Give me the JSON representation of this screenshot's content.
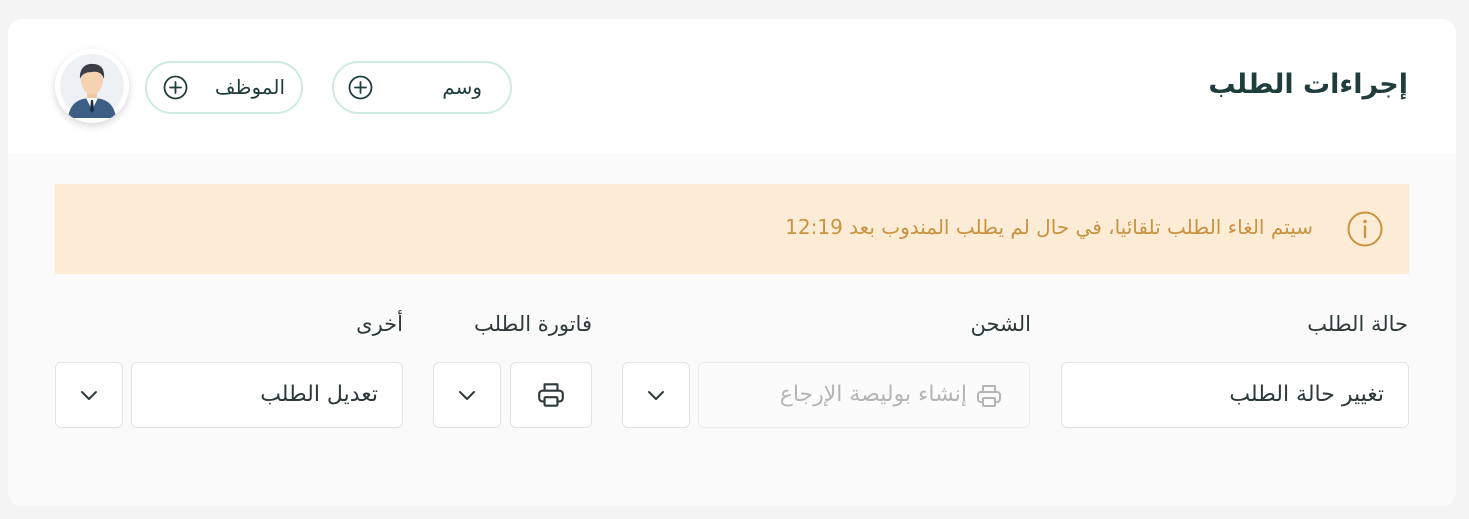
{
  "header": {
    "title": "إجراءات الطلب",
    "tag_button_label": "وسم",
    "staff_button_label": "الموظف"
  },
  "alert": {
    "message": "سيتم الغاء الطلب تلقائيا، في حال لم يطلب المندوب بعد 12:19"
  },
  "sections": {
    "order_status": {
      "label": "حالة الطلب",
      "value": "تغيير حالة الطلب"
    },
    "shipping": {
      "label": "الشحن",
      "placeholder": "إنشاء بوليصة الإرجاع"
    },
    "invoice": {
      "label": "فاتورة الطلب"
    },
    "other": {
      "label": "أخرى",
      "value": "تعديل الطلب"
    }
  },
  "colors": {
    "title": "#1f3d3c",
    "pill_border": "#cdebe1",
    "alert_bg": "#fcecd6",
    "alert_text": "#c99341"
  },
  "icons": [
    "plus-circle-icon",
    "user-avatar",
    "info-icon",
    "printer-icon",
    "chevron-down-icon"
  ]
}
